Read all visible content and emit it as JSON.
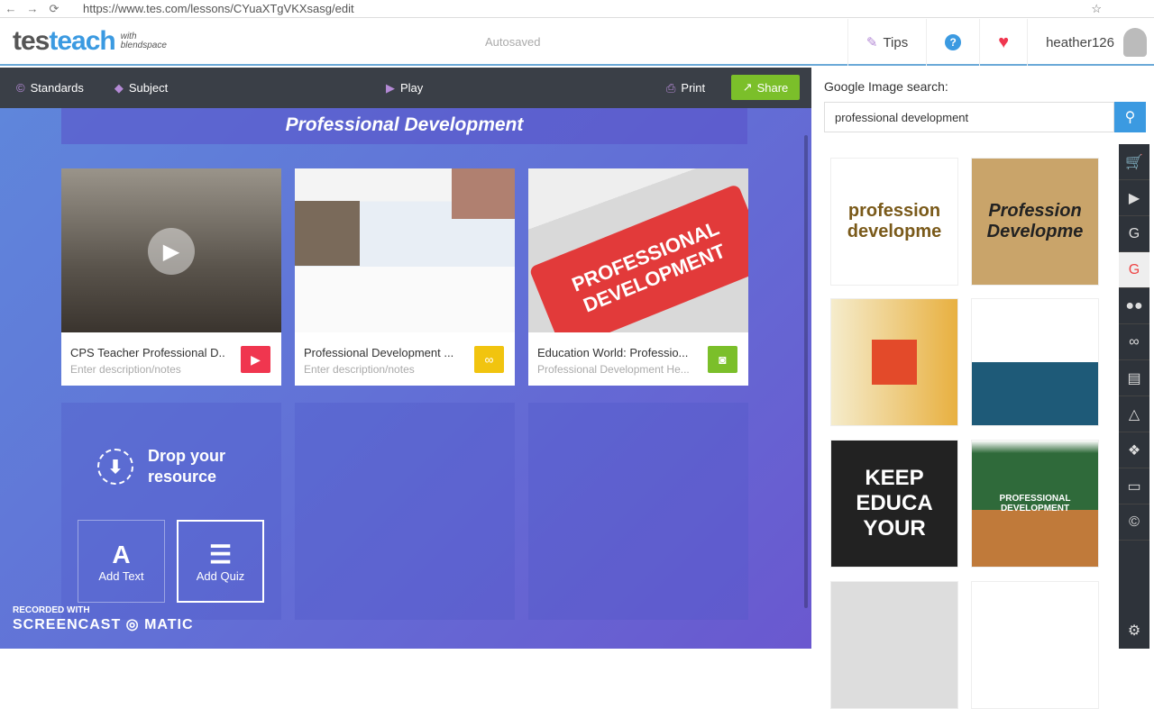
{
  "browser": {
    "url": "https://www.tes.com/lessons/CYuaXTgVKXsasg/edit"
  },
  "header": {
    "logo_tes": "tes",
    "logo_teach": "teach",
    "logo_with": "with",
    "logo_blendspace": "blendspace",
    "status": "Autosaved",
    "tips": "Tips",
    "help": "?",
    "username": "heather126"
  },
  "toolbar": {
    "standards": "Standards",
    "subject": "Subject",
    "play": "Play",
    "print": "Print",
    "share": "Share"
  },
  "lesson": {
    "title": "Professional Development",
    "cards": [
      {
        "title": "CPS Teacher Professional D..",
        "desc": "Enter description/notes",
        "type": "video",
        "color": "#f0364f"
      },
      {
        "title": "Professional Development ...",
        "desc": "Enter description/notes",
        "type": "link",
        "color": "#f1c40f"
      },
      {
        "title": "Education World: Professio...",
        "desc": "Professional Development He...",
        "type": "image",
        "color": "#7bbf2a"
      }
    ],
    "image3_text": "PROFESSIONAL DEVELOPMENT",
    "drop": "Drop your resource",
    "add_text": "Add Text",
    "add_text_icon": "A",
    "add_quiz": "Add Quiz"
  },
  "search": {
    "label": "Google Image search:",
    "value": "professional development"
  },
  "thumbs": [
    "profession developme",
    "Profession Developme",
    "",
    "",
    "KEEP EDUCA YOUR",
    "PROFESSIONAL DEVELOPMENT",
    "",
    ""
  ],
  "rail": [
    "cart-icon",
    "youtube-icon",
    "google-link-icon",
    "google-image-icon",
    "flickr-icon",
    "link-icon",
    "drive-icon",
    "google-drive-icon",
    "dropbox-icon",
    "desktop-icon",
    "standards-icon",
    "gear-icon"
  ],
  "watermark": {
    "line1": "RECORDED WITH",
    "line2": "SCREENCAST ◎ MATIC"
  }
}
